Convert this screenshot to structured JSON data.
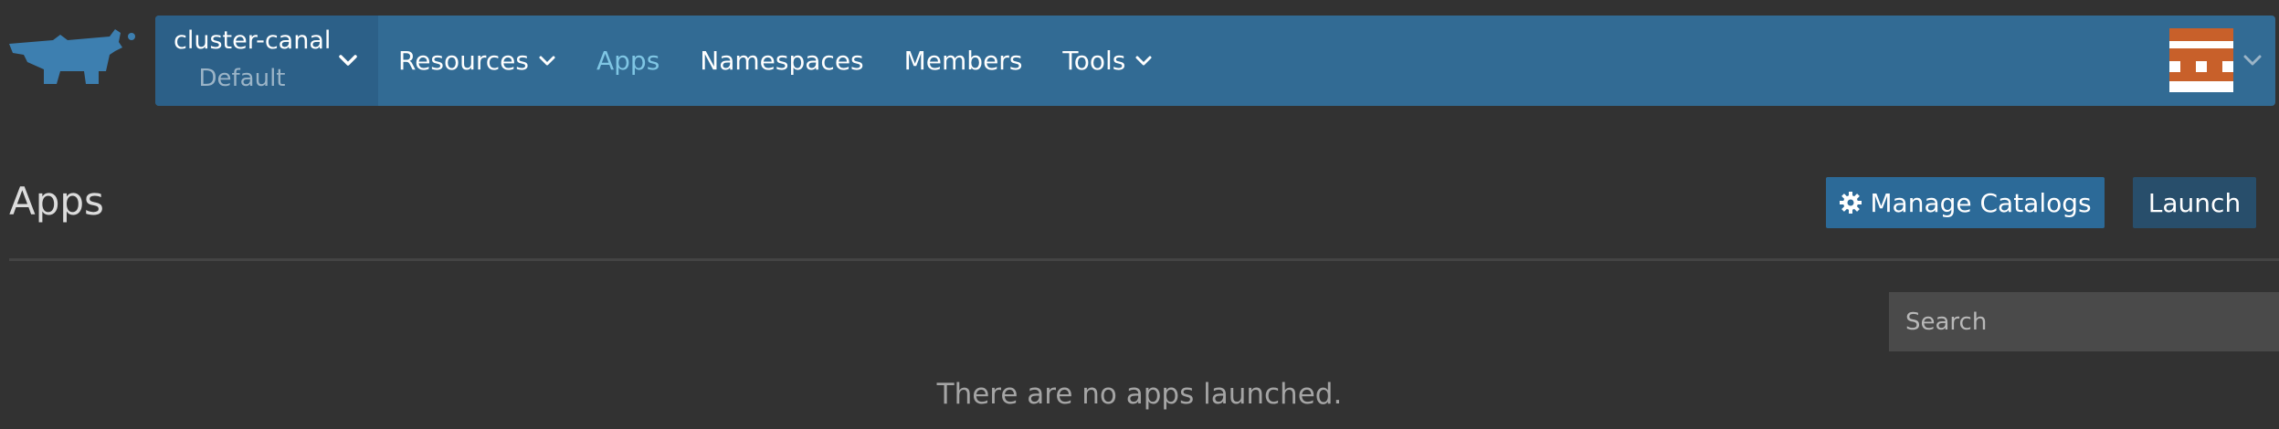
{
  "logo": {
    "icon": "rancher-logo-icon",
    "color": "#3d7fb0"
  },
  "topbar": {
    "background": "#326b94",
    "cluster": {
      "name": "cluster-canal",
      "project": "Default"
    },
    "nav": [
      {
        "label": "Resources",
        "has_dropdown": true,
        "active": false
      },
      {
        "label": "Apps",
        "has_dropdown": false,
        "active": true
      },
      {
        "label": "Namespaces",
        "has_dropdown": false,
        "active": false
      },
      {
        "label": "Members",
        "has_dropdown": false,
        "active": false
      },
      {
        "label": "Tools",
        "has_dropdown": true,
        "active": false
      }
    ],
    "user": {
      "avatar_icon": "user-avatar-icon",
      "avatar_color": "#c8602a"
    }
  },
  "main": {
    "title": "Apps",
    "manage_catalogs_label": "Manage Catalogs",
    "launch_label": "Launch",
    "search": {
      "placeholder": "Search",
      "value": ""
    },
    "empty_message": "There are no apps launched."
  }
}
